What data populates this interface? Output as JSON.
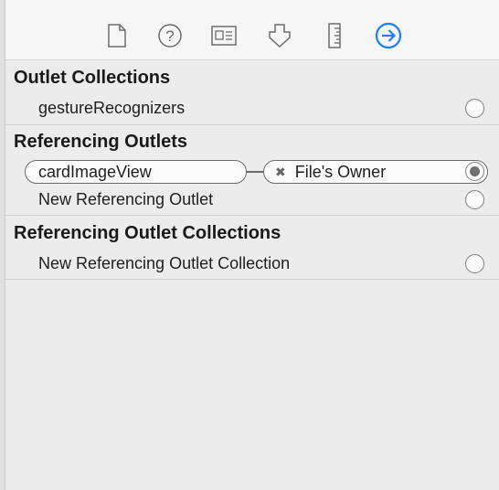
{
  "toolbar": {
    "icons": [
      {
        "name": "file-inspector-icon",
        "active": false
      },
      {
        "name": "quick-help-icon",
        "active": false
      },
      {
        "name": "identity-inspector-icon",
        "active": false
      },
      {
        "name": "attributes-inspector-icon",
        "active": false
      },
      {
        "name": "size-inspector-icon",
        "active": false
      },
      {
        "name": "connections-inspector-icon",
        "active": true
      }
    ],
    "active_color": "#1f7ef0",
    "inactive_color": "#6b6b6b"
  },
  "sections": {
    "outlet_collections": {
      "title": "Outlet Collections",
      "items": [
        {
          "label": "gestureRecognizers"
        }
      ]
    },
    "referencing_outlets": {
      "title": "Referencing Outlets",
      "connection": {
        "source": "cardImageView",
        "target": "File's Owner",
        "remove_glyph": "✖"
      },
      "new_item": "New Referencing Outlet"
    },
    "referencing_outlet_collections": {
      "title": "Referencing Outlet Collections",
      "new_item": "New Referencing Outlet Collection"
    }
  }
}
